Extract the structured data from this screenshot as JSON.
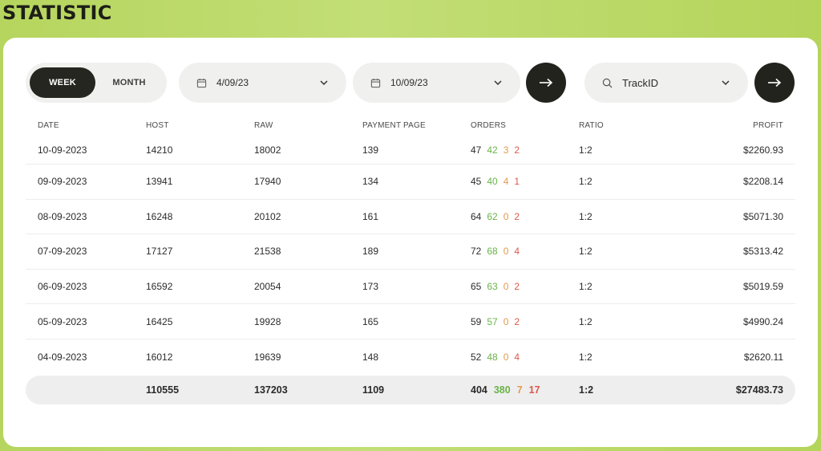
{
  "page": {
    "title": "STATISTIC"
  },
  "controls": {
    "period_toggle": {
      "active": "WEEK",
      "inactive": "MONTH"
    },
    "date_from": "4/09/23",
    "date_to": "10/09/23",
    "search": {
      "value": "TrackID"
    },
    "icons": {
      "calendar": "calendar-icon",
      "chevron": "chevron-down-icon",
      "arrow": "arrow-right-icon",
      "search": "search-icon"
    }
  },
  "table": {
    "columns": [
      "DATE",
      "HOST",
      "RAW",
      "PAYMENT PAGE",
      "ORDERS",
      "RATIO",
      "PROFIT"
    ],
    "rows": [
      {
        "date": "10-09-2023",
        "host": "14210",
        "raw": "18002",
        "payment_page": "139",
        "orders": {
          "total": "47",
          "green": "42",
          "orange": "3",
          "red": "2"
        },
        "ratio": "1:2",
        "profit": "$2260.93"
      },
      {
        "date": "09-09-2023",
        "host": "13941",
        "raw": "17940",
        "payment_page": "134",
        "orders": {
          "total": "45",
          "green": "40",
          "orange": "4",
          "red": "1"
        },
        "ratio": "1:2",
        "profit": "$2208.14"
      },
      {
        "date": "08-09-2023",
        "host": "16248",
        "raw": "20102",
        "payment_page": "161",
        "orders": {
          "total": "64",
          "green": "62",
          "orange": "0",
          "red": "2"
        },
        "ratio": "1:2",
        "profit": "$5071.30"
      },
      {
        "date": "07-09-2023",
        "host": "17127",
        "raw": "21538",
        "payment_page": "189",
        "orders": {
          "total": "72",
          "green": "68",
          "orange": "0",
          "red": "4"
        },
        "ratio": "1:2",
        "profit": "$5313.42"
      },
      {
        "date": "06-09-2023",
        "host": "16592",
        "raw": "20054",
        "payment_page": "173",
        "orders": {
          "total": "65",
          "green": "63",
          "orange": "0",
          "red": "2"
        },
        "ratio": "1:2",
        "profit": "$5019.59"
      },
      {
        "date": "05-09-2023",
        "host": "16425",
        "raw": "19928",
        "payment_page": "165",
        "orders": {
          "total": "59",
          "green": "57",
          "orange": "0",
          "red": "2"
        },
        "ratio": "1:2",
        "profit": "$4990.24"
      },
      {
        "date": "04-09-2023",
        "host": "16012",
        "raw": "19639",
        "payment_page": "148",
        "orders": {
          "total": "52",
          "green": "48",
          "orange": "0",
          "red": "4"
        },
        "ratio": "1:2",
        "profit": "$2620.11"
      }
    ],
    "totals": {
      "host": "110555",
      "raw": "137203",
      "payment_page": "1109",
      "orders": {
        "total": "404",
        "green": "380",
        "orange": "7",
        "red": "17"
      },
      "ratio": "1:2",
      "profit": "$27483.73"
    }
  },
  "colors": {
    "accent_green": "#6bb34a",
    "accent_orange": "#e69a4d",
    "accent_red": "#dc5a4a",
    "dark": "#23231d",
    "background": "#b6d55e"
  }
}
